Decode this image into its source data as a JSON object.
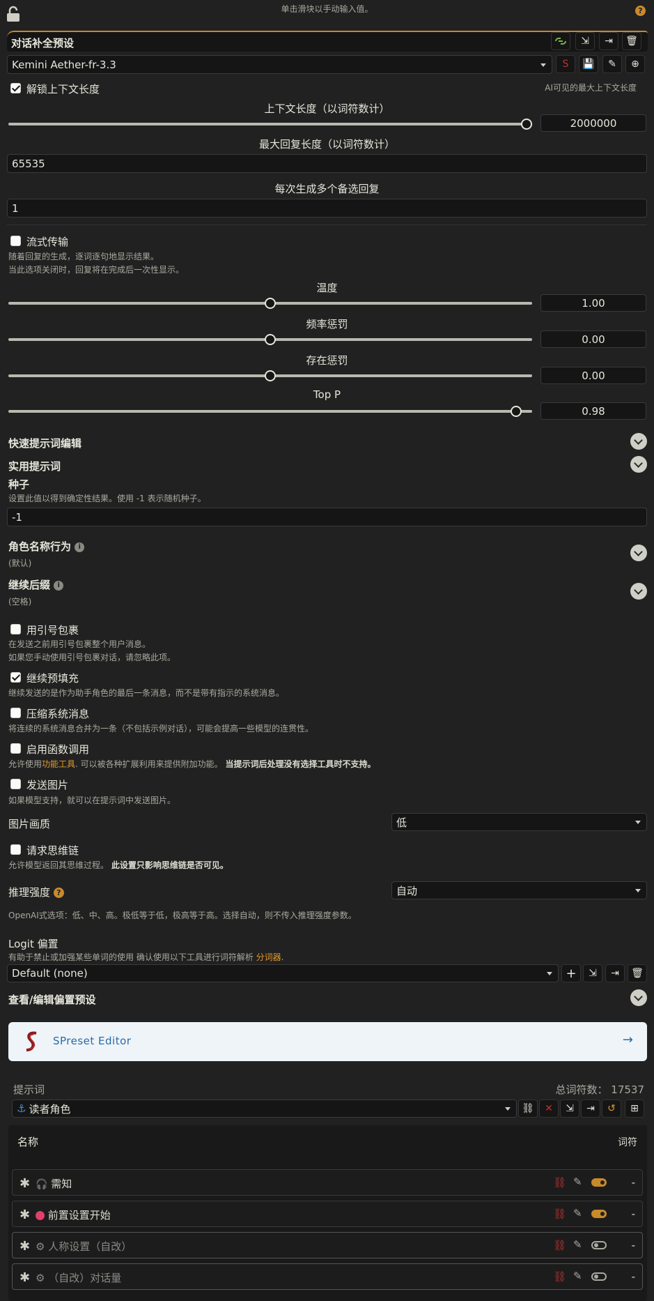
{
  "top": {
    "hint": "单击滑块以手动输入值。",
    "help": "?"
  },
  "preset": {
    "title": "对话补全预设",
    "selected": "Kemini Aether-fr-3.3"
  },
  "context": {
    "unlock_label": "解锁上下文长度",
    "unlock_checked": true,
    "ai_visible_hint": "AI可见的最大上下文长度",
    "length_label": "上下文长度（以词符数计）",
    "length_value": "2000000",
    "length_fraction": 1.0
  },
  "max_response": {
    "label": "最大回复长度（以词符数计）",
    "value": "65535"
  },
  "alternates": {
    "label": "每次生成多个备选回复",
    "value": "1"
  },
  "streaming": {
    "label": "流式传输",
    "checked": false,
    "desc1": "随着回复的生成，逐词逐句地显示结果。",
    "desc2": "当此选项关闭时，回复将在完成后一次性显示。"
  },
  "sliders": [
    {
      "label": "温度",
      "value": "1.00",
      "fraction": 0.5
    },
    {
      "label": "频率惩罚",
      "value": "0.00",
      "fraction": 0.5
    },
    {
      "label": "存在惩罚",
      "value": "0.00",
      "fraction": 0.5
    },
    {
      "label": "Top P",
      "value": "0.98",
      "fraction": 0.98
    }
  ],
  "sections": {
    "quick_edit": "快速提示词编辑",
    "utility": "实用提示词"
  },
  "seed": {
    "label": "种子",
    "desc": "设置此值以得到确定性结果。使用 -1 表示随机种子。",
    "value": "-1"
  },
  "char_name": {
    "label": "角色名称行为",
    "value": "(默认)"
  },
  "continue_suffix": {
    "label": "继续后缀",
    "value": "(空格)"
  },
  "options": [
    {
      "label": "用引号包裹",
      "checked": false,
      "desc1": "在发送之前用引号包裹整个用户消息。",
      "desc2": "如果您手动使用引号包裹对话，请忽略此项。"
    },
    {
      "label": "继续预填充",
      "checked": true,
      "desc1": "继续发送的是作为助手角色的最后一条消息，而不是带有指示的系统消息。"
    },
    {
      "label": "压缩系统消息",
      "checked": false,
      "desc1": "将连续的系统消息合并为一条（不包括示例对话），可能会提高一些模型的连贯性。"
    }
  ],
  "func_call": {
    "label": "启用函数调用",
    "checked": false,
    "desc_pre": "允许使用",
    "desc_link": "功能工具",
    "desc_mid": ". 可以被各种扩展利用来提供附加功能。",
    "desc_bold": "当提示词后处理没有选择工具时不支持。"
  },
  "send_images": {
    "label": "发送图片",
    "checked": false,
    "desc": "如果模型支持，就可以在提示词中发送图片。"
  },
  "image_quality": {
    "label": "图片画质",
    "value": "低"
  },
  "reasoning_req": {
    "label": "请求思维链",
    "checked": false,
    "desc_pre": "允许模型返回其思维过程。",
    "desc_bold": "此设置只影响思维链是否可见。"
  },
  "reasoning_effort": {
    "label": "推理强度",
    "value": "自动",
    "desc": "OpenAI式选项：低、中、高。极低等于低，极高等于高。选择自动，则不传入推理强度参数。"
  },
  "logit": {
    "label": "Logit 偏置",
    "desc_pre": "有助于禁止或加强某些单词的使用 确认使用以下工具进行词符解析",
    "desc_link": "分词器",
    "desc_end": ".",
    "preset": "Default (none)",
    "view_edit": "查看/编辑偏置预设"
  },
  "spreset": {
    "label": "SPreset Editor",
    "arrow": "→"
  },
  "prompts": {
    "label": "提示词",
    "total_label": "总词符数：",
    "total_value": "17537",
    "selected": "读者角色",
    "col_name": "名称",
    "col_tokens": "词符",
    "rows": [
      {
        "name": "需知",
        "icon": "headphones-icon",
        "enabled": true,
        "tokens": "-"
      },
      {
        "name": "前置设置开始",
        "icon": "pink-dot-icon",
        "enabled": true,
        "tokens": "-"
      },
      {
        "name": "人称设置（自改）",
        "icon": "gear-icon",
        "enabled": false,
        "tokens": "-"
      },
      {
        "name": "（自改）对话量",
        "icon": "gear-icon",
        "enabled": false,
        "tokens": "-"
      }
    ]
  }
}
